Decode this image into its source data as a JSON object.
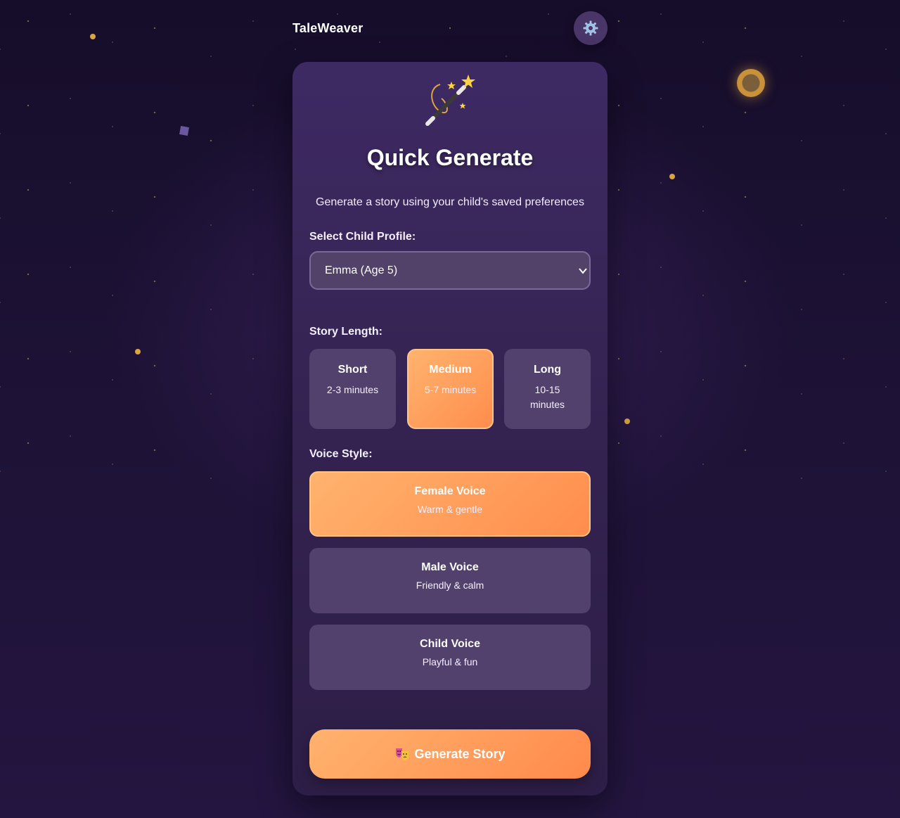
{
  "app": {
    "brand": "TaleWeaver"
  },
  "header": {
    "settings_icon": "gear-icon"
  },
  "card": {
    "hero_icon": "magic-wand-icon",
    "title": "Quick Generate",
    "subtitle": "Generate a story using your child's saved preferences"
  },
  "profile": {
    "label": "Select Child Profile:",
    "selected": "Emma (Age 5)"
  },
  "length": {
    "label": "Story Length:",
    "options": [
      {
        "title": "Short",
        "subtitle": "2-3 minutes",
        "selected": false
      },
      {
        "title": "Medium",
        "subtitle": "5-7 minutes",
        "selected": true
      },
      {
        "title": "Long",
        "subtitle": "10-15 minutes",
        "selected": false
      }
    ]
  },
  "voice": {
    "label": "Voice Style:",
    "options": [
      {
        "title": "Female Voice",
        "subtitle": "Warm & gentle",
        "selected": true
      },
      {
        "title": "Male Voice",
        "subtitle": "Friendly & calm",
        "selected": false
      },
      {
        "title": "Child Voice",
        "subtitle": "Playful & fun",
        "selected": false
      }
    ]
  },
  "generate": {
    "icon": "theater-masks-icon",
    "label": "Generate Story"
  },
  "colors": {
    "accent_start": "#ffb36e",
    "accent_end": "#ff8d4d",
    "card_bg": "#3e2a63",
    "option_bg": "#52416c"
  }
}
